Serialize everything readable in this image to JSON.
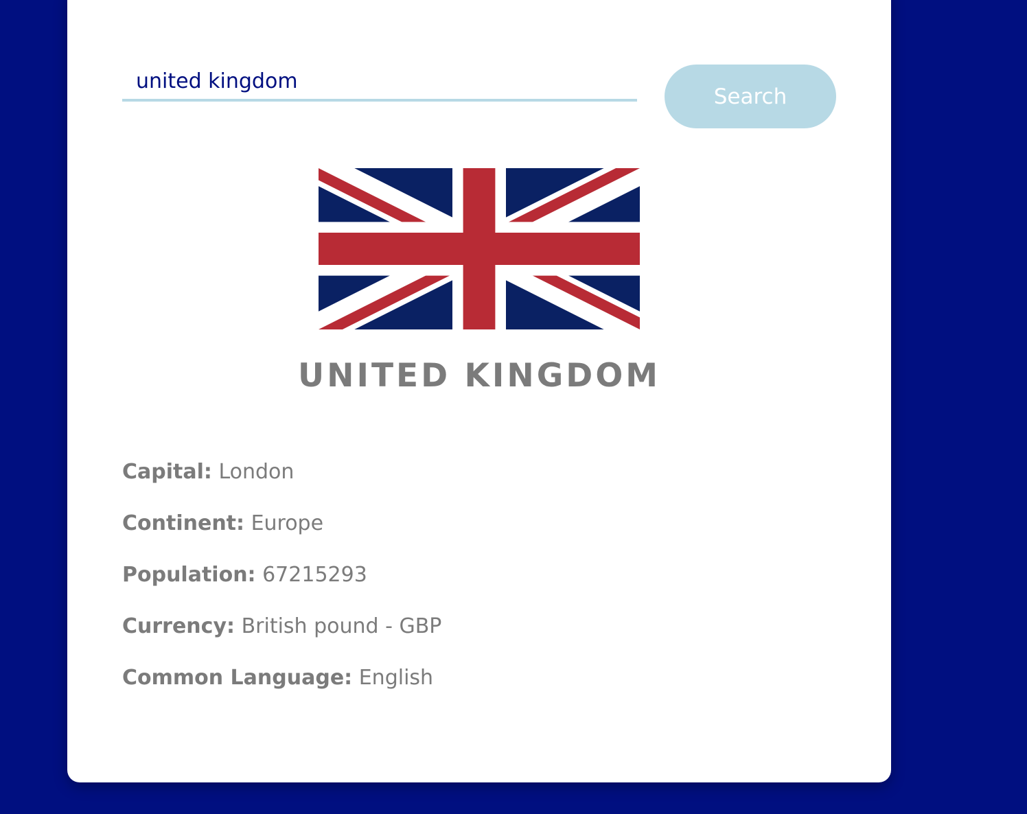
{
  "search": {
    "value": "united kingdom",
    "button_label": "Search"
  },
  "country": {
    "name": "UNITED KINGDOM",
    "flag_icon": "union-jack-flag",
    "details": [
      {
        "label": "Capital:",
        "value": "London"
      },
      {
        "label": "Continent:",
        "value": "Europe"
      },
      {
        "label": "Population:",
        "value": "67215293"
      },
      {
        "label": "Currency:",
        "value": "British pound - GBP"
      },
      {
        "label": "Common Language:",
        "value": "English"
      }
    ]
  },
  "colors": {
    "background": "#000f80",
    "accent": "#b7d9e5",
    "text": "#7b7b7b",
    "flag_blue": "#012169",
    "flag_red": "#c8102e"
  }
}
